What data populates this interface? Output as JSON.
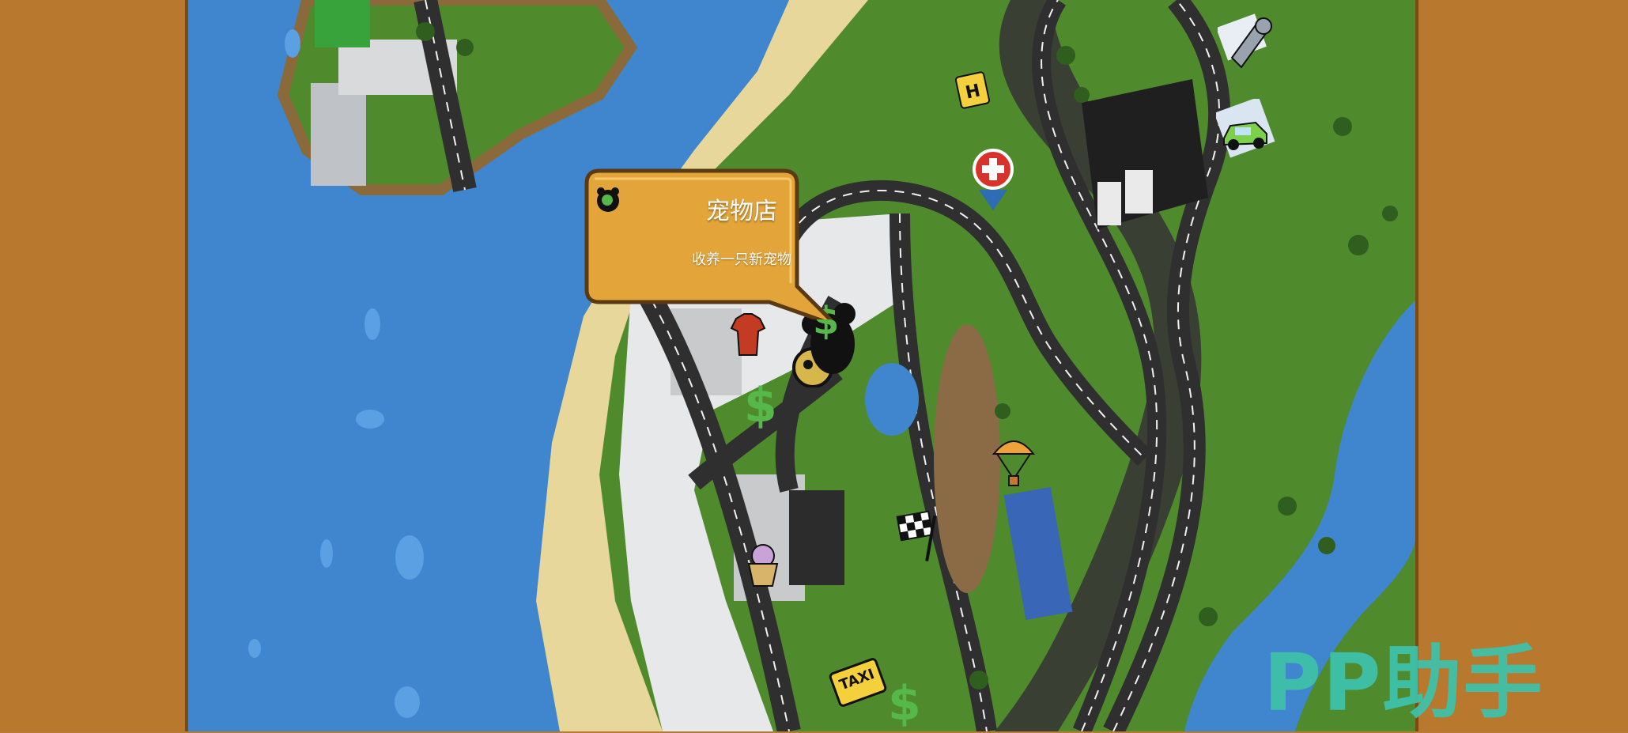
{
  "tooltip": {
    "title": "宠物店",
    "description": "收养一只新宠物",
    "icon": "paw-icon"
  },
  "watermark": "PP助手",
  "taxi_sign": "TAXI",
  "map_icons": [
    "paw-icon",
    "money-icon",
    "shirt-icon",
    "ice-cream-icon",
    "taxi-icon",
    "finish-flag-icon",
    "parachute-icon",
    "first-aid-icon",
    "helipad-icon",
    "wrench-icon",
    "car-icon"
  ],
  "colors": {
    "water": "#3f86cf",
    "grass": "#4f8a2c",
    "sand": "#e8d79a",
    "road": "#2f2f2f",
    "frame": "#b8792f",
    "tooltip": "#e3a43a"
  }
}
